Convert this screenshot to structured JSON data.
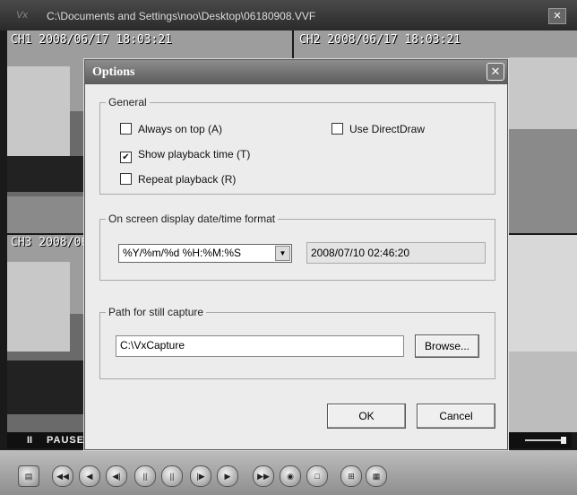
{
  "window": {
    "app_icon": "Vx",
    "title": "C:\\Documents and Settings\\noo\\Desktop\\06180908.VVF"
  },
  "channels": {
    "ch1": "CH1 2008/06/17 18:03:21",
    "ch2": "CH2 2008/06/17 18:03:21",
    "ch3": "CH3 2008/06"
  },
  "playback": {
    "pause_icon": "II",
    "pause_label": "PAUSE"
  },
  "toolbar": {
    "buttons": [
      "open-icon",
      "fast-rewind-icon",
      "rewind-icon",
      "step-back-icon",
      "slow-back-icon",
      "pause-icon",
      "slow-forward-icon",
      "play-icon",
      "fast-forward-icon",
      "snapshot-icon",
      "single-view-icon",
      "quad-view-icon",
      "grid-view-icon"
    ]
  },
  "dialog": {
    "title": "Options",
    "general": {
      "legend": "General",
      "always_on_top": {
        "label": "Always on top (A)",
        "checked": false
      },
      "show_playback_time": {
        "label": "Show playback time (T)",
        "checked": true
      },
      "repeat_playback": {
        "label": "Repeat playback (R)",
        "checked": false
      },
      "use_directdraw": {
        "label": "Use DirectDraw",
        "checked": false
      }
    },
    "osd": {
      "legend": "On screen display date/time format",
      "format_value": "%Y/%m/%d %H:%M:%S",
      "preview": "2008/07/10 02:46:20"
    },
    "capture": {
      "legend": "Path for still capture",
      "path_value": "C:\\VxCapture",
      "browse_label": "Browse..."
    },
    "ok_label": "OK",
    "cancel_label": "Cancel"
  }
}
